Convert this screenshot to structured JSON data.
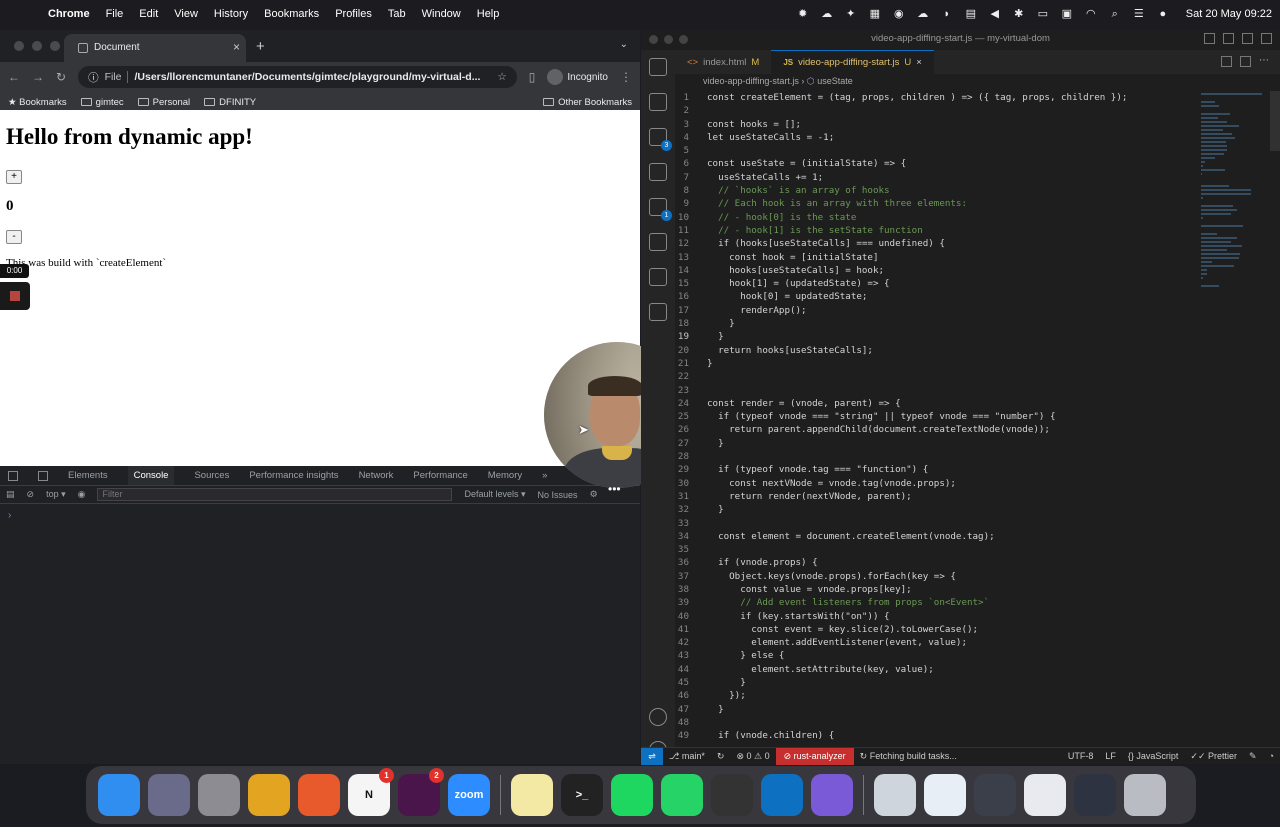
{
  "menubar": {
    "app": "Chrome",
    "items": [
      "File",
      "Edit",
      "View",
      "History",
      "Bookmarks",
      "Profiles",
      "Tab",
      "Window",
      "Help"
    ],
    "clock": "Sat 20 May  09:22"
  },
  "chrome": {
    "tab_title": "Document",
    "address_source": "File",
    "address_path": "/Users/llorencmuntaner/Documents/gimtec/playground/my-virtual-d...",
    "profile": "Incognito",
    "bookmarks": [
      "Bookmarks",
      "gimtec",
      "Personal",
      "DFINITY"
    ],
    "other_bookmarks": "Other Bookmarks"
  },
  "page": {
    "heading": "Hello from dynamic app!",
    "plus_label": "+",
    "count": "0",
    "minus_label": "-",
    "paragraph": "This was build with `createElement`",
    "rec_time": "0:00"
  },
  "devtools": {
    "tabs": [
      "Elements",
      "Console",
      "Sources",
      "Performance insights",
      "Network",
      "Performance",
      "Memory"
    ],
    "more": "»",
    "context": "top",
    "filter_placeholder": "Filter",
    "levels": "Default levels",
    "issues": "No Issues",
    "prompt": "›"
  },
  "vscode": {
    "window_title": "video-app-diffing-start.js — my-virtual-dom",
    "tabs": [
      {
        "name": "index.html",
        "status": "M"
      },
      {
        "name": "video-app-diffing-start.js",
        "status": "U"
      }
    ],
    "breadcrumb_file": "video-app-diffing-start.js",
    "breadcrumb_symbol": "useState",
    "code": [
      {
        "n": "1",
        "t": "const createElement = (tag, props, children ) => ({ tag, props, children });"
      },
      {
        "n": "2",
        "t": ""
      },
      {
        "n": "3",
        "t": "const hooks = [];"
      },
      {
        "n": "4",
        "t": "let useStateCalls = -1;"
      },
      {
        "n": "5",
        "t": ""
      },
      {
        "n": "6",
        "t": "const useState = (initialState) => {"
      },
      {
        "n": "7",
        "t": "  useStateCalls += 1;"
      },
      {
        "n": "8",
        "t": "  // `hooks` is an array of hooks"
      },
      {
        "n": "9",
        "t": "  // Each hook is an array with three elements:"
      },
      {
        "n": "10",
        "t": "  // - hook[0] is the state"
      },
      {
        "n": "11",
        "t": "  // - hook[1] is the setState function"
      },
      {
        "n": "12",
        "t": "  if (hooks[useStateCalls] === undefined) {"
      },
      {
        "n": "13",
        "t": "    const hook = [initialState]"
      },
      {
        "n": "14",
        "t": "    hooks[useStateCalls] = hook;"
      },
      {
        "n": "15",
        "t": "    hook[1] = (updatedState) => {"
      },
      {
        "n": "16",
        "t": "      hook[0] = updatedState;"
      },
      {
        "n": "17",
        "t": "      renderApp();"
      },
      {
        "n": "18",
        "t": "    }"
      },
      {
        "n": "19",
        "t": "  }"
      },
      {
        "n": "20",
        "t": "  return hooks[useStateCalls];"
      },
      {
        "n": "21",
        "t": "}"
      },
      {
        "n": "22",
        "t": ""
      },
      {
        "n": "23",
        "t": ""
      },
      {
        "n": "24",
        "t": "const render = (vnode, parent) => {"
      },
      {
        "n": "25",
        "t": "  if (typeof vnode === \"string\" || typeof vnode === \"number\") {"
      },
      {
        "n": "26",
        "t": "    return parent.appendChild(document.createTextNode(vnode));"
      },
      {
        "n": "27",
        "t": "  }"
      },
      {
        "n": "28",
        "t": ""
      },
      {
        "n": "29",
        "t": "  if (typeof vnode.tag === \"function\") {"
      },
      {
        "n": "30",
        "t": "    const nextVNode = vnode.tag(vnode.props);"
      },
      {
        "n": "31",
        "t": "    return render(nextVNode, parent);"
      },
      {
        "n": "32",
        "t": "  }"
      },
      {
        "n": "33",
        "t": ""
      },
      {
        "n": "34",
        "t": "  const element = document.createElement(vnode.tag);"
      },
      {
        "n": "35",
        "t": ""
      },
      {
        "n": "36",
        "t": "  if (vnode.props) {"
      },
      {
        "n": "37",
        "t": "    Object.keys(vnode.props).forEach(key => {"
      },
      {
        "n": "38",
        "t": "      const value = vnode.props[key];"
      },
      {
        "n": "39",
        "t": "      // Add event listeners from props `on<Event>`"
      },
      {
        "n": "40",
        "t": "      if (key.startsWith(\"on\")) {"
      },
      {
        "n": "41",
        "t": "        const event = key.slice(2).toLowerCase();"
      },
      {
        "n": "42",
        "t": "        element.addEventListener(event, value);"
      },
      {
        "n": "43",
        "t": "      } else {"
      },
      {
        "n": "44",
        "t": "        element.setAttribute(key, value);"
      },
      {
        "n": "45",
        "t": "      }"
      },
      {
        "n": "46",
        "t": "    });"
      },
      {
        "n": "47",
        "t": "  }"
      },
      {
        "n": "48",
        "t": ""
      },
      {
        "n": "49",
        "t": "  if (vnode.children) {"
      }
    ],
    "current_line": "19",
    "status": {
      "branch": "main*",
      "problems": "0",
      "warnings": "0",
      "analyzer": "rust-analyzer",
      "task": "Fetching build tasks...",
      "encoding": "UTF-8",
      "eol": "LF",
      "language": "JavaScript",
      "formatter": "Prettier"
    }
  },
  "dock": {
    "apps": [
      {
        "name": "finder",
        "color": "#2f8ef0",
        "label": ""
      },
      {
        "name": "launchpad",
        "color": "#6a6a8a",
        "label": ""
      },
      {
        "name": "system-settings",
        "color": "#8c8c92",
        "label": ""
      },
      {
        "name": "chrome",
        "color": "#e3a521",
        "label": ""
      },
      {
        "name": "firefox",
        "color": "#e85a2c",
        "label": ""
      },
      {
        "name": "notion",
        "color": "#f5f5f5",
        "label": "N",
        "badge": "1"
      },
      {
        "name": "slack",
        "color": "#4a154b",
        "label": "",
        "badge": "2"
      },
      {
        "name": "zoom",
        "color": "#2d8cff",
        "label": "zoom"
      },
      {
        "name": "notes",
        "color": "#f3e8a4",
        "label": ""
      },
      {
        "name": "terminal",
        "color": "#222",
        "label": ">_"
      },
      {
        "name": "spotify",
        "color": "#1ed760",
        "label": ""
      },
      {
        "name": "whatsapp",
        "color": "#25d366",
        "label": ""
      },
      {
        "name": "davinci",
        "color": "#333",
        "label": ""
      },
      {
        "name": "vscode",
        "color": "#0e70c0",
        "label": ""
      },
      {
        "name": "vscode-insiders",
        "color": "#7a5ad6",
        "label": ""
      },
      {
        "name": "preview",
        "color": "#cfd5dc",
        "label": ""
      },
      {
        "name": "document-thumb",
        "color": "#e8eef6",
        "label": ""
      },
      {
        "name": "screens-thumb",
        "color": "#3a3f4a",
        "label": ""
      },
      {
        "name": "browser-thumb",
        "color": "#e8eaef",
        "label": ""
      },
      {
        "name": "window-thumb",
        "color": "#2d3340",
        "label": ""
      },
      {
        "name": "trash",
        "color": "#b9bcc2",
        "label": ""
      }
    ]
  }
}
